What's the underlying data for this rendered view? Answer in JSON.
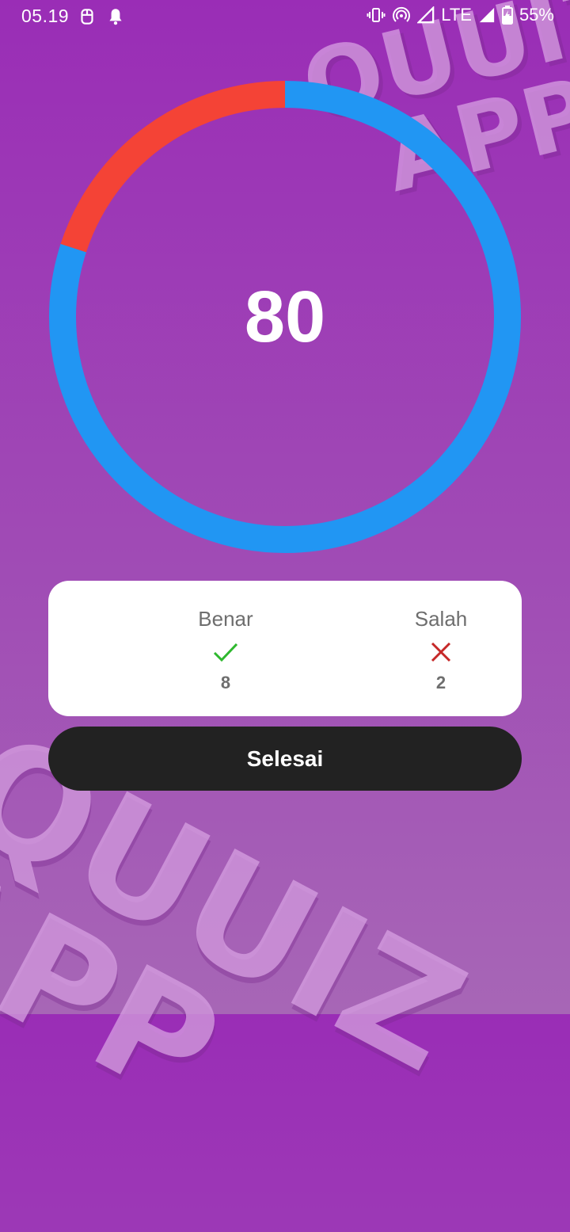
{
  "status_bar": {
    "time": "05.19",
    "network": "LTE",
    "battery": "55%",
    "icons": [
      "sim-icon",
      "notification-bell-icon",
      "vibrate-icon",
      "hotspot-icon",
      "signal-icon",
      "signal-icon",
      "battery-charging-icon"
    ]
  },
  "watermark": {
    "line1": "QUUIZ",
    "line2": "APP"
  },
  "score": {
    "value": "80",
    "correct_fraction": 0.8,
    "correct_color": "#2196F3",
    "wrong_color": "#F44336"
  },
  "results": {
    "correct_label": "Benar",
    "correct_count": "8",
    "correct_icon": "check-icon",
    "correct_icon_color": "#2eb82e",
    "wrong_label": "Salah",
    "wrong_count": "2",
    "wrong_icon": "close-icon",
    "wrong_icon_color": "#c62828"
  },
  "done_button": {
    "label": "Selesai"
  }
}
